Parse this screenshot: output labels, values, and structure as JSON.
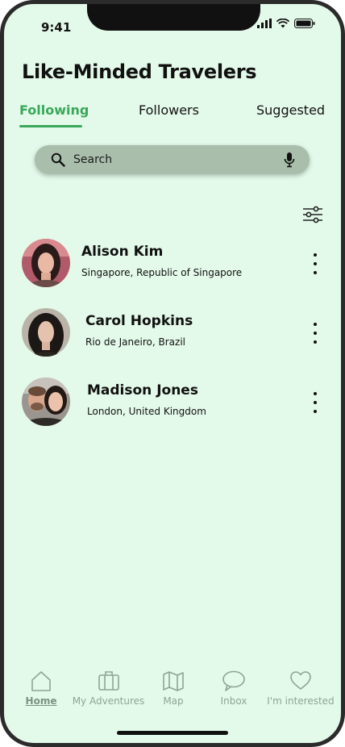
{
  "status_bar": {
    "time": "9:41"
  },
  "header": {
    "title": "Like-Minded Travelers"
  },
  "tabs": [
    {
      "label": "Following",
      "active": true
    },
    {
      "label": "Followers",
      "active": false
    },
    {
      "label": "Suggested",
      "active": false
    }
  ],
  "search": {
    "placeholder": "Search",
    "value": ""
  },
  "people": [
    {
      "name": "Alison Kim",
      "location": "Singapore, Republic of Singapore"
    },
    {
      "name": "Carol Hopkins",
      "location": "Rio de Janeiro, Brazil"
    },
    {
      "name": "Madison Jones",
      "location": "London, United Kingdom"
    }
  ],
  "bottom_nav": [
    {
      "label": "Home",
      "icon": "home-icon",
      "active": true
    },
    {
      "label": "My Adventures",
      "icon": "suitcase-icon",
      "active": false
    },
    {
      "label": "Map",
      "icon": "map-icon",
      "active": false
    },
    {
      "label": "Inbox",
      "icon": "chat-bubble-icon",
      "active": false
    },
    {
      "label": "I'm interested",
      "icon": "heart-icon",
      "active": false
    }
  ],
  "colors": {
    "background": "#e3f9e9",
    "accent": "#3aa85a",
    "search_bg": "#a9bfac",
    "nav_inactive": "#8da592"
  }
}
